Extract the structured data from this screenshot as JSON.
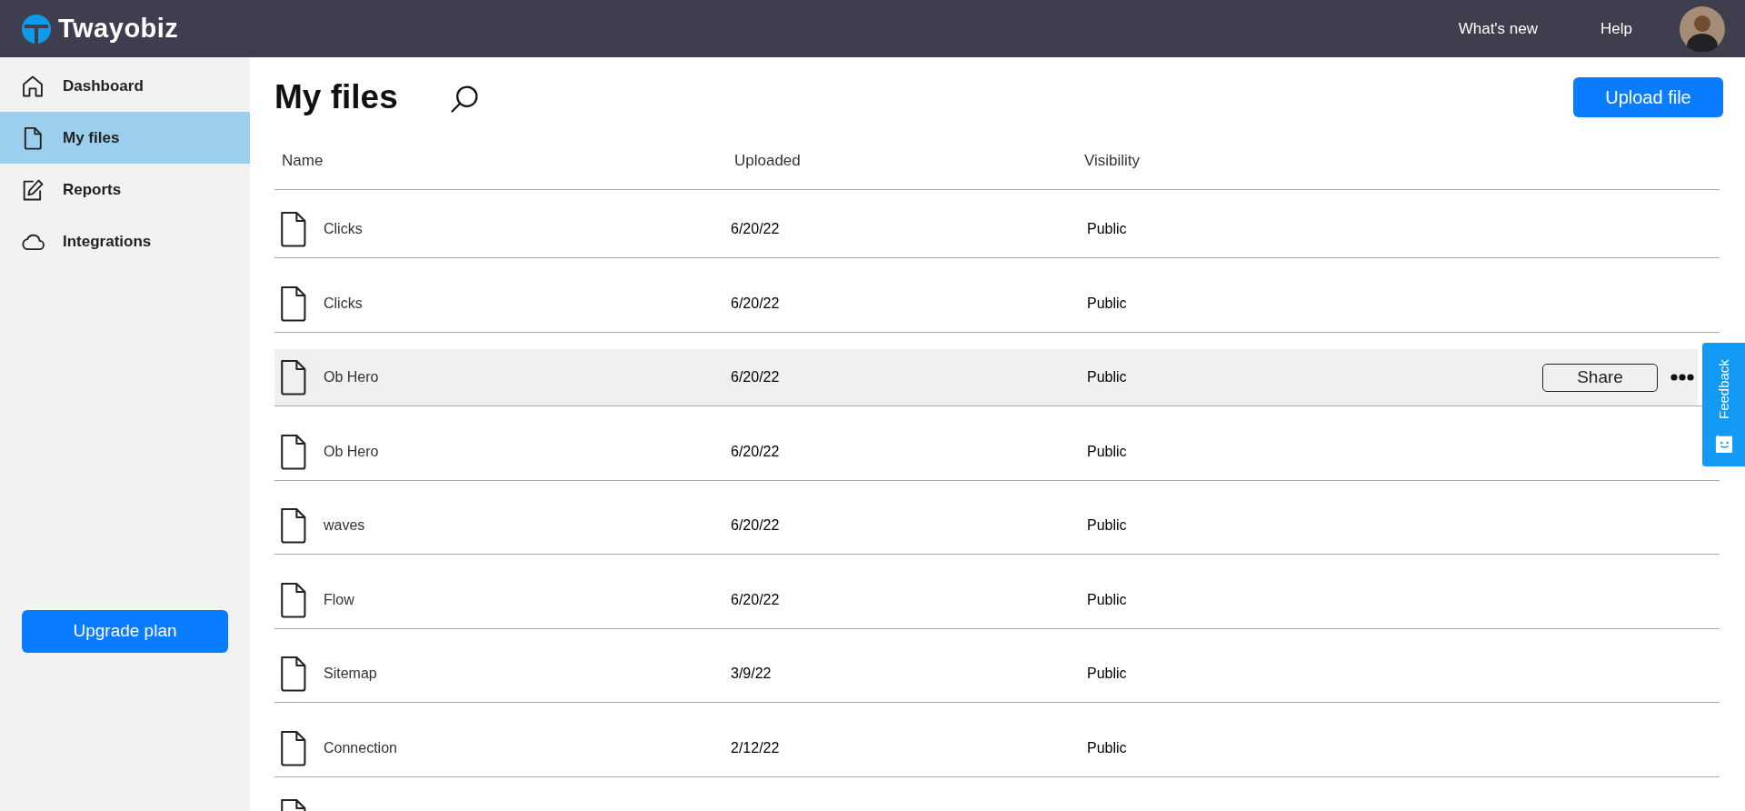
{
  "header": {
    "logo": "Twayobiz",
    "links": [
      "What's new",
      "Help"
    ]
  },
  "sidebar": {
    "items": [
      {
        "label": "Dashboard",
        "selected": false
      },
      {
        "label": "My files",
        "selected": true
      },
      {
        "label": "Reports",
        "selected": false
      },
      {
        "label": "Integrations",
        "selected": false
      }
    ],
    "upgrade_button": "Upgrade plan"
  },
  "main": {
    "title": "My files",
    "upload_button": "Upload file",
    "table": {
      "columns": [
        "Name",
        "Uploaded",
        "Visibility"
      ],
      "rows": [
        {
          "name": "Clicks",
          "uploaded": "6/20/22",
          "visibility": "Public",
          "hovered": false
        },
        {
          "name": "Clicks",
          "uploaded": "6/20/22",
          "visibility": "Public",
          "hovered": false
        },
        {
          "name": "Ob Hero",
          "uploaded": "6/20/22",
          "visibility": "Public",
          "hovered": true
        },
        {
          "name": "Ob Hero",
          "uploaded": "6/20/22",
          "visibility": "Public",
          "hovered": false
        },
        {
          "name": "waves",
          "uploaded": "6/20/22",
          "visibility": "Public",
          "hovered": false
        },
        {
          "name": "Flow",
          "uploaded": "6/20/22",
          "visibility": "Public",
          "hovered": false
        },
        {
          "name": "Sitemap",
          "uploaded": "3/9/22",
          "visibility": "Public",
          "hovered": false
        },
        {
          "name": "Connection",
          "uploaded": "2/12/22",
          "visibility": "Public",
          "hovered": false
        }
      ],
      "row_action": "Share"
    }
  },
  "feedback_tab": "Feedback"
}
